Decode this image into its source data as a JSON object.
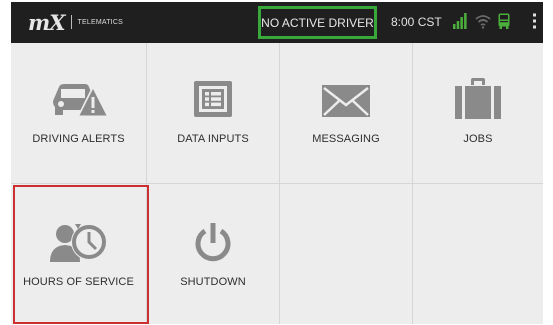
{
  "statusbar": {
    "logo_mark": "mX",
    "logo_text": "TELEMATICS",
    "driver_status": "NO ACTIVE DRIVER",
    "clock": "8:00 CST",
    "icons": [
      "signal-bars-icon",
      "wifi-icon",
      "bus-icon",
      "overflow-menu-icon"
    ],
    "accent_color": "#38a83b"
  },
  "tiles": [
    {
      "label": "DRIVING ALERTS",
      "icon": "driving-alert-icon"
    },
    {
      "label": "DATA INPUTS",
      "icon": "data-inputs-icon"
    },
    {
      "label": "MESSAGING",
      "icon": "envelope-icon"
    },
    {
      "label": "JOBS",
      "icon": "briefcase-icon"
    },
    {
      "label": "HOURS OF SERVICE",
      "icon": "hours-of-service-icon",
      "selected": true
    },
    {
      "label": "SHUTDOWN",
      "icon": "power-icon"
    }
  ],
  "colors": {
    "icon_gray": "#8a8a8a",
    "selection_border": "#cc2f2f"
  }
}
